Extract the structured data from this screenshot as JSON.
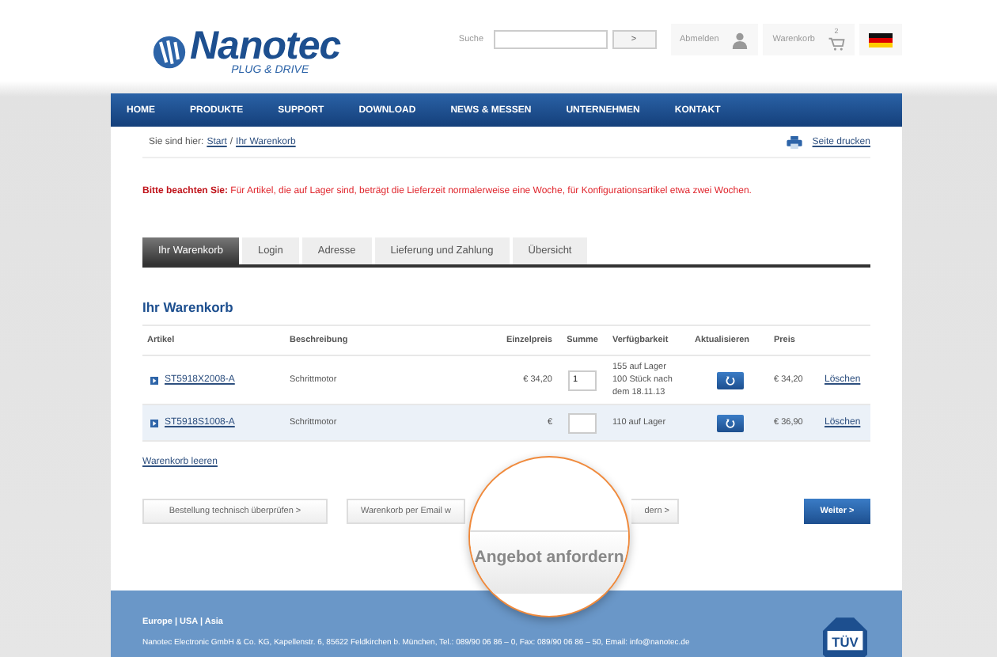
{
  "header": {
    "logo": {
      "name": "Nanotec",
      "tagline": "PLUG & DRIVE"
    },
    "search": {
      "label": "Suche",
      "button": ">"
    },
    "logout": "Abmelden",
    "cart": {
      "label": "Warenkorb",
      "count": "2"
    }
  },
  "nav": [
    "HOME",
    "PRODUKTE",
    "SUPPORT",
    "DOWNLOAD",
    "NEWS & MESSEN",
    "UNTERNEHMEN",
    "KONTAKT"
  ],
  "breadcrumb": {
    "label": "Sie sind hier:",
    "items": [
      "Start",
      "Ihr Warenkorb"
    ],
    "separator": "/"
  },
  "print": "Seite drucken",
  "notice": "**Bitte beachten Sie:** Für Artikel, die auf Lager sind, beträgt die Lieferzeit normalerweise eine Woche, für Konfigurationsartikel etwa zwei Wochen.",
  "tabs": [
    {
      "label": "Ihr Warenkorb",
      "selected": true
    },
    {
      "label": "Login",
      "selected": false
    },
    {
      "label": "Adresse",
      "selected": false
    },
    {
      "label": "Lieferung und Zahlung",
      "selected": false
    },
    {
      "label": "Übersicht",
      "selected": false
    }
  ],
  "cart": {
    "title": "Ihr Warenkorb",
    "columns": [
      "Artikel",
      "Beschreibung",
      "Einzelpreis",
      "Summe",
      "Verfügbarkeit",
      "Aktualisieren",
      "Preis"
    ],
    "rows": [
      {
        "article": "ST5918X2008-A",
        "description": "Schrittmotor",
        "unit_price": "€ 34,20",
        "quantity": "1",
        "availability": [
          "155 auf Lager",
          "100 Stück nach dem 18.11.13"
        ],
        "price": "€ 34,20",
        "delete": "Löschen",
        "highlighted": false
      },
      {
        "article": "ST5918S1008-A",
        "description": "Schrittmotor",
        "unit_price": "€",
        "availability": [
          "110 auf Lager"
        ],
        "price": "€ 36,90",
        "delete": "Löschen",
        "highlighted": true
      }
    ]
  },
  "clear_link": "Warenkorb leeren",
  "buttons": [
    {
      "label": "Bestellung technisch überprüfen >",
      "kind": "secondary"
    },
    {
      "label": "Warenkorb per Email w",
      "kind": "cut_right"
    },
    {
      "label": "dern >",
      "kind": "cut_left"
    },
    {
      "label": "Weiter >",
      "kind": "primary"
    }
  ],
  "magnifier": {
    "label": "Angebot anfordern"
  },
  "footer": {
    "seal": "TÜV",
    "regions": "Europe | USA | Asia",
    "address": "Nanotec Electronic GmbH & Co. KG,  Kapellenstr. 6, 85622 Feldkirchen b. München, Tel.: 089/90 06 86 – 0, Fax: 089/90 06 86 – 50,  Email: info@nanotec.de"
  }
}
